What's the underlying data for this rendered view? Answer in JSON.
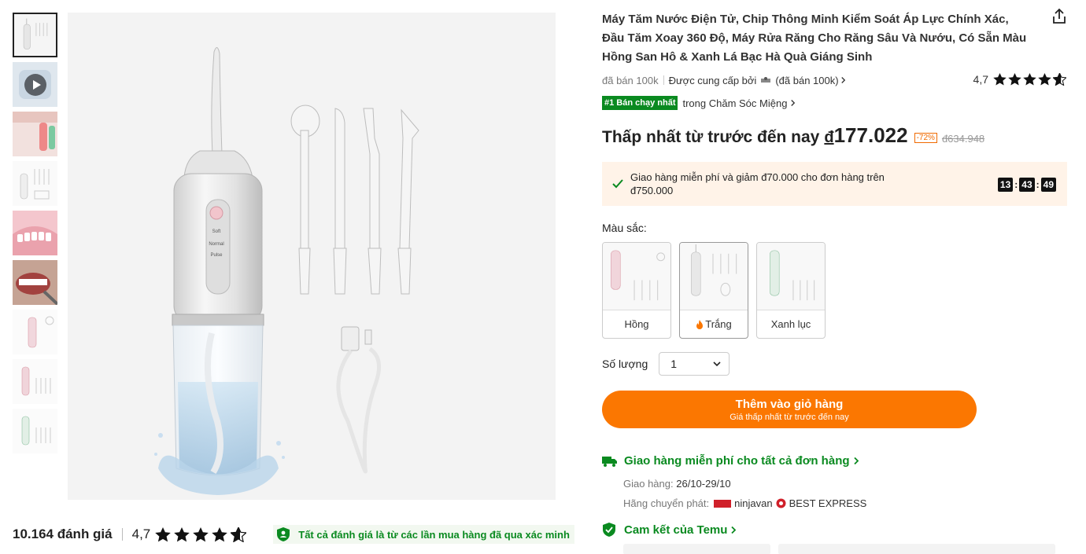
{
  "thumbnails": [
    {
      "kind": "white-main",
      "active": true
    },
    {
      "kind": "video"
    },
    {
      "kind": "red-promo"
    },
    {
      "kind": "white-set"
    },
    {
      "kind": "gum"
    },
    {
      "kind": "teeth"
    },
    {
      "kind": "pink-set"
    },
    {
      "kind": "pink-set-2"
    },
    {
      "kind": "green-set"
    }
  ],
  "main_image": {
    "device_labels": [
      "Soft",
      "Normal",
      "Pulse"
    ]
  },
  "reviews": {
    "count_text": "10.164 đánh giá",
    "rating": "4,7",
    "verified_text": "Tất cả đánh giá là từ các lần mua hàng đã qua xác minh"
  },
  "product": {
    "title": "Máy Tăm Nước Điện Tử, Chip Thông Minh Kiểm Soát Áp Lực Chính Xác, Đầu Tăm Xoay 360 Độ, Máy Rửa Răng Cho Răng Sâu Và Nướu, Có Sẵn Màu Hồng San Hô & Xanh Lá Bạc Hà Quà Giáng Sinh",
    "sold_text": "đã bán 100k",
    "supplied_by": "Được cung cấp bởi",
    "supplier_sold": "(đã bán 100k)",
    "rating": "4,7",
    "best_badge": "#1 Bán chạy nhất",
    "best_category": "trong Chăm Sóc Miệng"
  },
  "price": {
    "label": "Thấp nhất từ trước đến nay",
    "currency": "đ",
    "current": "177.022",
    "discount": "-72%",
    "old": "đ634.948"
  },
  "shipping_promo": {
    "text": "Giao hàng miễn phí và giảm đ70.000 cho đơn hàng trên đ750.000",
    "timer": [
      "13",
      "43",
      "49"
    ]
  },
  "color": {
    "label": "Màu sắc:",
    "options": [
      {
        "label": "Hồng",
        "accent": "#e8a6b4"
      },
      {
        "label": "Trắng",
        "accent": "#cfcfcf",
        "hot": true
      },
      {
        "label": "Xanh lục",
        "accent": "#9fcfb0"
      }
    ]
  },
  "quantity": {
    "label": "Số lượng",
    "value": "1"
  },
  "cart_button": {
    "label": "Thêm vào giỏ hàng",
    "sub": "Giá thấp nhất từ trước đến nay"
  },
  "delivery": {
    "free_text": "Giao hàng miễn phí cho tất cả đơn hàng",
    "date_label": "Giao hàng:",
    "date_value": "26/10-29/10",
    "carrier_label": "Hãng chuyển phát:",
    "carrier1": "ninjavan",
    "carrier2": "BEST EXPRESS"
  },
  "commitment": {
    "label": "Cam kết của Temu"
  },
  "colors": {
    "accent_orange": "#fb7701",
    "green": "#0a8a20",
    "promo_bg": "#fff3e8"
  }
}
